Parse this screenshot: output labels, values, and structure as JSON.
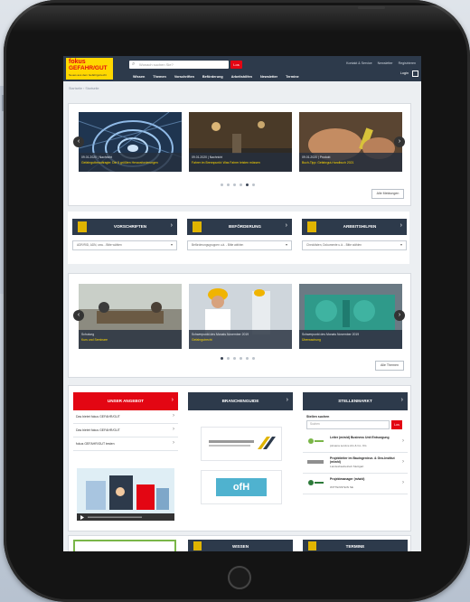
{
  "brand": {
    "line1": "fokus",
    "line2": "GEFAHR/GUT",
    "line3": "Neues aus dem Gefahrgutrecht"
  },
  "header": {
    "search_placeholder": "Wonach suchen Sie?",
    "search_button": "Los",
    "top_links": [
      "Kontakt & Service",
      "Newsletter",
      "Registrieren"
    ],
    "nav": [
      "Wissen",
      "Themen",
      "Vorschriften",
      "Beförderung",
      "Arbeitshilfen",
      "Newsletter",
      "Termine"
    ],
    "login": "Login"
  },
  "breadcrumb": "Startseite  ›  Startseite",
  "news_carousel": {
    "slides": [
      {
        "date": "09.01.2020 | Nachricht",
        "title": "Gefahrgutbeauftragte: Die 5 größten Herausforderungen"
      },
      {
        "date": "09.01.2020 | Nachricht",
        "title": "Fahrer im Brennpunkt: Was Fahrer leisten müssen"
      },
      {
        "date": "09.01.2020 | Produkt",
        "title": "Buch-Tipp: Gefahrgut-Handbuch 2021"
      }
    ],
    "active_dot": 4,
    "dot_count": 6,
    "all_button": "Alle Meldungen"
  },
  "categories": [
    {
      "label": "VORSCHRIFTEN",
      "select": "ADR/RID, ADN, usw. - Bitte wählen"
    },
    {
      "label": "BEFÖRDERUNG",
      "select": "Beförderungsgruppen u.ä. - Bitte wählen"
    },
    {
      "label": "ARBEITSHILFEN",
      "select": "Checklisten, Dokumente u.ä. - Bitte wählen"
    }
  ],
  "topics_carousel": {
    "slides": [
      {
        "date": "Schulung",
        "title": "Kurs und Seminare"
      },
      {
        "date": "Schwerpunkt des Monats November 2019",
        "title": "Gefahrgutrecht"
      },
      {
        "date": "Schwerpunkt des Monats November 2019",
        "title": "Überwachung"
      }
    ],
    "active_dot": 1,
    "dot_count": 6,
    "all_button": "Alle Themen"
  },
  "angebot": {
    "title": "UNSER ANGEBOT",
    "items": [
      "Das bietet fokus GEFAHR/GUT",
      "Das bietet fokus GEFAHR/GUT",
      "fokus GEFAHR/GUT testen"
    ]
  },
  "branchenguide": {
    "title": "BRANCHENGUIDE",
    "logo2": "ofH"
  },
  "stellenmarkt": {
    "title": "STELLENMARKT",
    "search_label": "Stellen suchen",
    "search_placeholder": "Suchen",
    "search_button": "Los",
    "jobs": [
      {
        "logo": "Logo",
        "title": "Leiter (m/w/d) Business Unit Entsorgung",
        "company": "pinsana service AG & Co. KG"
      },
      {
        "logo": "Logo",
        "title": "Projektleiter im Bauingenieur- & Geo-Institut (m/w/d)",
        "company": "Landesbaubetrieb Stuttgart"
      },
      {
        "logo": "Logo",
        "title": "Projektmanager (m/w/d)",
        "company": "WITTENSTEIN SE"
      }
    ]
  },
  "lower_sections": [
    "WISSEN",
    "TERMINE"
  ],
  "colors": {
    "navy": "#2d3a4b",
    "red": "#e30613",
    "yellow": "#ffd800"
  }
}
